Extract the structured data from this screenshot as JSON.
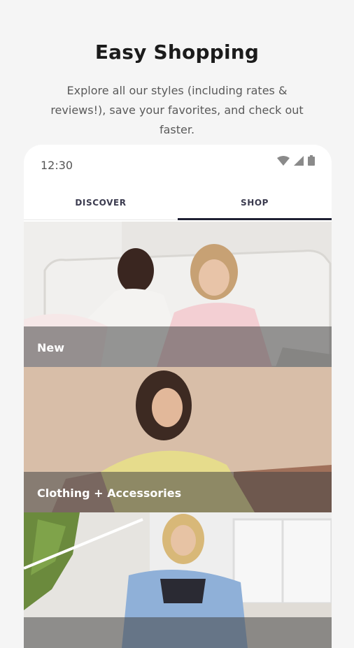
{
  "promo": {
    "title": "Easy Shopping",
    "description": "Explore all our styles (including rates & reviews!), save your favorites, and check out faster."
  },
  "status_bar": {
    "time": "12:30",
    "icons": [
      "wifi-icon",
      "signal-icon",
      "battery-icon"
    ]
  },
  "tabs": [
    {
      "label": "DISCOVER",
      "active": false
    },
    {
      "label": "SHOP",
      "active": true
    }
  ],
  "categories": [
    {
      "label": "New"
    },
    {
      "label": "Clothing + Accessories"
    },
    {
      "label": ""
    }
  ],
  "colors": {
    "background": "#f5f5f5",
    "tab_indicator": "#1f2033",
    "overlay": "rgba(70,70,70,0.55)"
  }
}
